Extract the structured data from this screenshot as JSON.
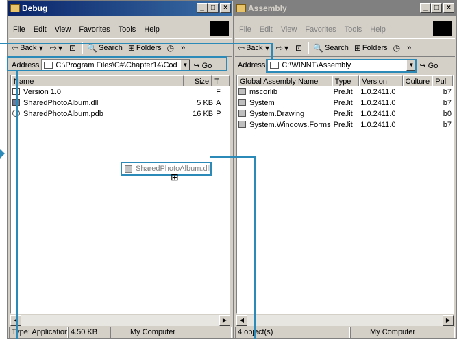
{
  "left_window": {
    "title": "Debug",
    "menu": [
      "File",
      "Edit",
      "View",
      "Favorites",
      "Tools",
      "Help"
    ],
    "toolbar": {
      "back": "Back",
      "search": "Search",
      "folders": "Folders"
    },
    "address_label": "Address",
    "address_value": "C:\\Program Files\\C#\\Chapter14\\Cod",
    "go": "Go",
    "columns": [
      "Name",
      "Size",
      "T"
    ],
    "files": [
      {
        "name": "Version 1.0",
        "size": "",
        "type": "F"
      },
      {
        "name": "SharedPhotoAlbum.dll",
        "size": "5 KB",
        "type": "A"
      },
      {
        "name": "SharedPhotoAlbum.pdb",
        "size": "16 KB",
        "type": "P"
      }
    ],
    "status": {
      "type": "Type: Application",
      "size": "4.50 KB",
      "location": "My Computer"
    }
  },
  "right_window": {
    "title": "Assembly",
    "menu": [
      "File",
      "Edit",
      "View",
      "Favorites",
      "Tools",
      "Help"
    ],
    "toolbar": {
      "back": "Back",
      "search": "Search",
      "folders": "Folders"
    },
    "address_label": "Address",
    "address_value": "C:\\WINNT\\Assembly",
    "go": "Go",
    "columns": [
      "Global Assembly Name",
      "Type",
      "Version",
      "Culture",
      "Pul"
    ],
    "assemblies": [
      {
        "name": "mscorlib",
        "type": "PreJit",
        "version": "1.0.2411.0",
        "culture": "",
        "key": "b7"
      },
      {
        "name": "System",
        "type": "PreJit",
        "version": "1.0.2411.0",
        "culture": "",
        "key": "b7"
      },
      {
        "name": "System.Drawing",
        "type": "PreJit",
        "version": "1.0.2411.0",
        "culture": "",
        "key": "b0"
      },
      {
        "name": "System.Windows.Forms",
        "type": "PreJit",
        "version": "1.0.2411.0",
        "culture": "",
        "key": "b7"
      }
    ],
    "status": {
      "objects": "4 object(s)",
      "location": "My Computer"
    }
  },
  "drag_ghost": {
    "label": "SharedPhotoAlbum.dll"
  },
  "accent_color": "#2b8ab8"
}
